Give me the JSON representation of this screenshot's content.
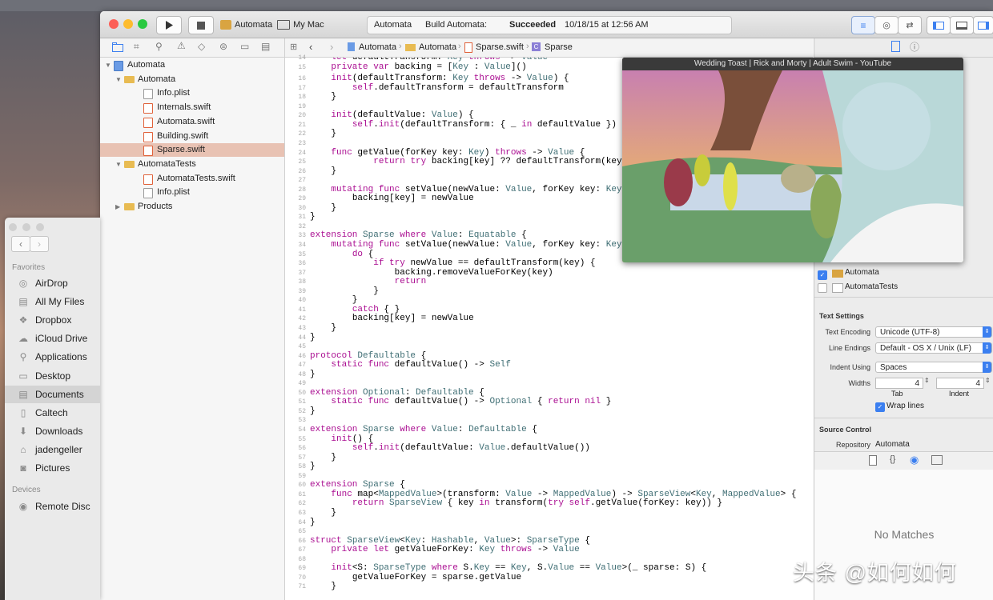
{
  "toolbar": {
    "scheme": "Automata",
    "destination": "My Mac",
    "status_project": "Automata",
    "status_build_prefix": "Build Automata:",
    "status_build_result": "Succeeded",
    "status_time": "10/18/15 at 12:56 AM"
  },
  "jumpbar": {
    "crumbs": [
      "Automata",
      "Automata",
      "Sparse.swift",
      "Sparse"
    ]
  },
  "navigator": {
    "items": [
      {
        "label": "Automata",
        "kind": "project",
        "indent": 0,
        "disclosure": "▼"
      },
      {
        "label": "Automata",
        "kind": "folder",
        "indent": 1,
        "disclosure": "▼"
      },
      {
        "label": "Info.plist",
        "kind": "file",
        "indent": 2
      },
      {
        "label": "Internals.swift",
        "kind": "swift",
        "indent": 2
      },
      {
        "label": "Automata.swift",
        "kind": "swift",
        "indent": 2
      },
      {
        "label": "Building.swift",
        "kind": "swift",
        "indent": 2
      },
      {
        "label": "Sparse.swift",
        "kind": "swift",
        "indent": 2,
        "selected": true
      },
      {
        "label": "AutomataTests",
        "kind": "folder",
        "indent": 1,
        "disclosure": "▼"
      },
      {
        "label": "AutomataTests.swift",
        "kind": "swift",
        "indent": 2
      },
      {
        "label": "Info.plist",
        "kind": "file",
        "indent": 2
      },
      {
        "label": "Products",
        "kind": "folder",
        "indent": 1,
        "disclosure": "▶"
      }
    ]
  },
  "editor": {
    "lines": [
      {
        "n": "14",
        "t": "    let defaultTransform: Key throws -> Value"
      },
      {
        "n": "15",
        "t": "    private var backing = [Key : Value]()"
      },
      {
        "n": "",
        "t": ""
      },
      {
        "n": "16",
        "t": "    init(defaultTransform: Key throws -> Value) {"
      },
      {
        "n": "17",
        "t": "        self.defaultTransform = defaultTransform"
      },
      {
        "n": "18",
        "t": "    }"
      },
      {
        "n": "19",
        "t": ""
      },
      {
        "n": "20",
        "t": "    init(defaultValue: Value) {"
      },
      {
        "n": "21",
        "t": "        self.init(defaultTransform: { _ in defaultValue })"
      },
      {
        "n": "22",
        "t": "    }"
      },
      {
        "n": "23",
        "t": ""
      },
      {
        "n": "24",
        "t": "    func getValue(forKey key: Key) throws -> Value {"
      },
      {
        "n": "25",
        "t": "            return try backing[key] ?? defaultTransform(key)"
      },
      {
        "n": "26",
        "t": "    }"
      },
      {
        "n": "27",
        "t": ""
      },
      {
        "n": "28",
        "t": "    mutating func setValue(newValue: Value, forKey key: Key) {"
      },
      {
        "n": "29",
        "t": "        backing[key] = newValue"
      },
      {
        "n": "30",
        "t": "    }"
      },
      {
        "n": "31",
        "t": "}"
      },
      {
        "n": "32",
        "t": ""
      },
      {
        "n": "33",
        "t": "extension Sparse where Value: Equatable {"
      },
      {
        "n": "34",
        "t": "    mutating func setValue(newValue: Value, forKey key: Key) {"
      },
      {
        "n": "35",
        "t": "        do {"
      },
      {
        "n": "36",
        "t": "            if try newValue == defaultTransform(key) {"
      },
      {
        "n": "37",
        "t": "                backing.removeValueForKey(key)"
      },
      {
        "n": "38",
        "t": "                return"
      },
      {
        "n": "39",
        "t": "            }"
      },
      {
        "n": "40",
        "t": "        }"
      },
      {
        "n": "41",
        "t": "        catch { }"
      },
      {
        "n": "42",
        "t": "        backing[key] = newValue"
      },
      {
        "n": "43",
        "t": "    }"
      },
      {
        "n": "44",
        "t": "}"
      },
      {
        "n": "45",
        "t": ""
      },
      {
        "n": "46",
        "t": "protocol Defaultable {"
      },
      {
        "n": "47",
        "t": "    static func defaultValue() -> Self"
      },
      {
        "n": "48",
        "t": "}"
      },
      {
        "n": "49",
        "t": ""
      },
      {
        "n": "50",
        "t": "extension Optional: Defaultable {"
      },
      {
        "n": "51",
        "t": "    static func defaultValue() -> Optional { return nil }"
      },
      {
        "n": "52",
        "t": "}"
      },
      {
        "n": "53",
        "t": ""
      },
      {
        "n": "54",
        "t": "extension Sparse where Value: Defaultable {"
      },
      {
        "n": "55",
        "t": "    init() {"
      },
      {
        "n": "56",
        "t": "        self.init(defaultValue: Value.defaultValue())"
      },
      {
        "n": "57",
        "t": "    }"
      },
      {
        "n": "58",
        "t": "}"
      },
      {
        "n": "59",
        "t": ""
      },
      {
        "n": "60",
        "t": "extension Sparse {"
      },
      {
        "n": "61",
        "t": "    func map<MappedValue>(transform: Value -> MappedValue) -> SparseView<Key, MappedValue> {"
      },
      {
        "n": "62",
        "t": "        return SparseView { key in transform(try self.getValue(forKey: key)) }"
      },
      {
        "n": "63",
        "t": "    }"
      },
      {
        "n": "64",
        "t": "}"
      },
      {
        "n": "65",
        "t": ""
      },
      {
        "n": "66",
        "t": "struct SparseView<Key: Hashable, Value>: SparseType {"
      },
      {
        "n": "67",
        "t": "    private let getValueForKey: Key throws -> Value"
      },
      {
        "n": "68",
        "t": ""
      },
      {
        "n": "69",
        "t": "    init<S: SparseType where S.Key == Key, S.Value == Value>(_ sparse: S) {"
      },
      {
        "n": "70",
        "t": "        getValueForKey = sparse.getValue"
      },
      {
        "n": "71",
        "t": "    }"
      }
    ]
  },
  "video": {
    "title": "Wedding Toast | Rick and Morty | Adult Swim - YouTube"
  },
  "inspector": {
    "targets": [
      "Automata",
      "AutomataTests"
    ],
    "text_settings_title": "Text Settings",
    "text_encoding_label": "Text Encoding",
    "text_encoding_value": "Unicode (UTF-8)",
    "line_endings_label": "Line Endings",
    "line_endings_value": "Default - OS X / Unix (LF)",
    "indent_using_label": "Indent Using",
    "indent_using_value": "Spaces",
    "widths_label": "Widths",
    "tab_value": "4",
    "indent_value": "4",
    "tab_caption": "Tab",
    "indent_caption": "Indent",
    "wrap_lines_label": "Wrap lines",
    "source_control_title": "Source Control",
    "repository_label": "Repository",
    "repository_value": "Automata",
    "no_matches": "No Matches"
  },
  "finder": {
    "favorites_title": "Favorites",
    "favorites": [
      {
        "label": "AirDrop",
        "icon": "airdrop-icon",
        "glyph": "◎"
      },
      {
        "label": "All My Files",
        "icon": "all-files-icon",
        "glyph": "▤"
      },
      {
        "label": "Dropbox",
        "icon": "dropbox-icon",
        "glyph": "❖"
      },
      {
        "label": "iCloud Drive",
        "icon": "cloud-icon",
        "glyph": "☁"
      },
      {
        "label": "Applications",
        "icon": "applications-icon",
        "glyph": "⚲"
      },
      {
        "label": "Desktop",
        "icon": "desktop-icon",
        "glyph": "▭"
      },
      {
        "label": "Documents",
        "icon": "documents-icon",
        "glyph": "▤",
        "selected": true
      },
      {
        "label": "Caltech",
        "icon": "folder-doc-icon",
        "glyph": "▯"
      },
      {
        "label": "Downloads",
        "icon": "downloads-icon",
        "glyph": "⬇"
      },
      {
        "label": "jadengeller",
        "icon": "home-icon",
        "glyph": "⌂"
      },
      {
        "label": "Pictures",
        "icon": "camera-icon",
        "glyph": "◙"
      }
    ],
    "devices_title": "Devices",
    "devices": [
      {
        "label": "Remote Disc",
        "icon": "disc-icon",
        "glyph": "◉"
      }
    ]
  },
  "watermark": "头条 @如何如何",
  "colors": {
    "keyword": "#aa0d91",
    "type": "#3f6e74",
    "selection": "#e8c2b3",
    "accent": "#3b7ff0"
  }
}
